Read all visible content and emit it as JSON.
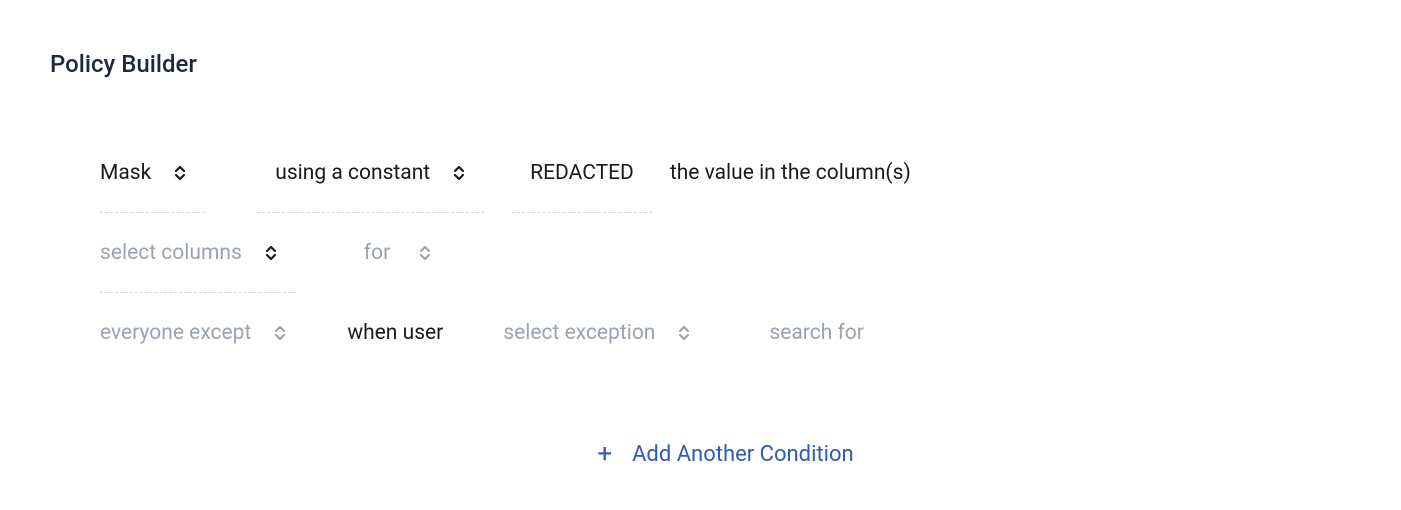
{
  "title": "Policy Builder",
  "row1": {
    "action_select": "Mask",
    "method_select": "using a constant",
    "constant_value": "REDACTED",
    "trailing_text": "the value in the column(s)"
  },
  "row2": {
    "columns_select": "select columns",
    "for_select": "for"
  },
  "row3": {
    "scope_select": "everyone except",
    "when_user": "when user",
    "exception_select": "select exception",
    "search_for": "search for"
  },
  "add_condition": {
    "label": "Add Another Condition",
    "plus": "+"
  }
}
